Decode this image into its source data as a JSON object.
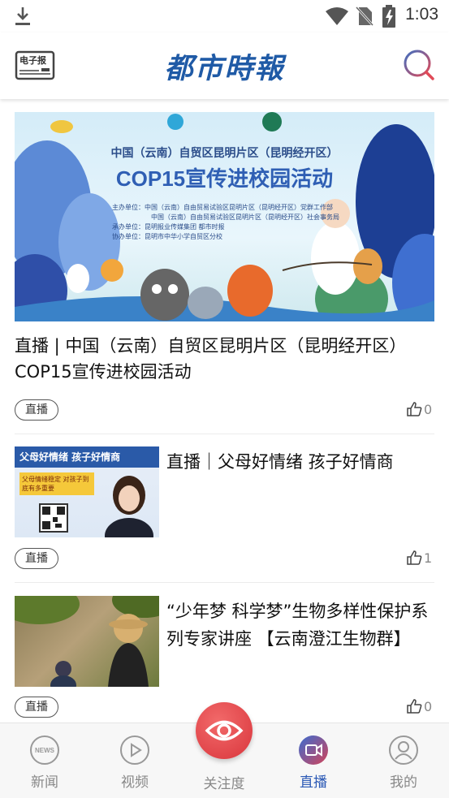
{
  "status_bar": {
    "time": "1:03",
    "icons": [
      "download-icon",
      "wifi-icon",
      "no-sim-icon",
      "battery-charging-icon"
    ]
  },
  "header": {
    "logo_text": "都市時報",
    "left_icon_label": "电子报",
    "left_icon": "newspaper-icon",
    "right_icon": "search-icon",
    "colors": {
      "logo": "#1f5aa6",
      "search_ring": "#d24a5a"
    }
  },
  "feed": {
    "featured": {
      "banner": {
        "line1": "中国（云南）自贸区昆明片区（昆明经开区）",
        "line2": "COP15宣传进校园活动",
        "info": [
          "主办单位：中国（云南）自由贸易试验区昆明片区（昆明经开区）党群工作部",
          "中国（云南）自由贸易试验区昆明片区（昆明经开区）社会事务局",
          "承办单位：昆明报业传媒集团 都市时报",
          "协办单位：昆明市中华小学自贸区分校"
        ]
      },
      "title": "直播 | 中国（云南）自贸区昆明片区（昆明经开区）COP15宣传进校园活动",
      "tag": "直播",
      "likes": "0"
    },
    "items": [
      {
        "title": "直播｜父母好情绪  孩子好情商",
        "thumb_header": "父母好情绪  孩子好情商",
        "thumb_sub": "父母情绪稳定 对孩子到底有多重要",
        "tag": "直播",
        "likes": "1"
      },
      {
        "title": "“少年梦 科学梦”生物多样性保护系列专家讲座 【云南澄江生物群】",
        "tag": "直播",
        "likes": "0"
      }
    ]
  },
  "bottom_nav": {
    "items": [
      {
        "label": "新闻",
        "icon": "news-icon"
      },
      {
        "label": "视频",
        "icon": "play-icon"
      },
      {
        "label": "关注度",
        "icon": "eye-icon"
      },
      {
        "label": "直播",
        "icon": "live-camera-icon"
      },
      {
        "label": "我的",
        "icon": "user-icon"
      }
    ],
    "active": "直播",
    "colors": {
      "active": "#2b59b5",
      "center": "#d9353c"
    }
  }
}
